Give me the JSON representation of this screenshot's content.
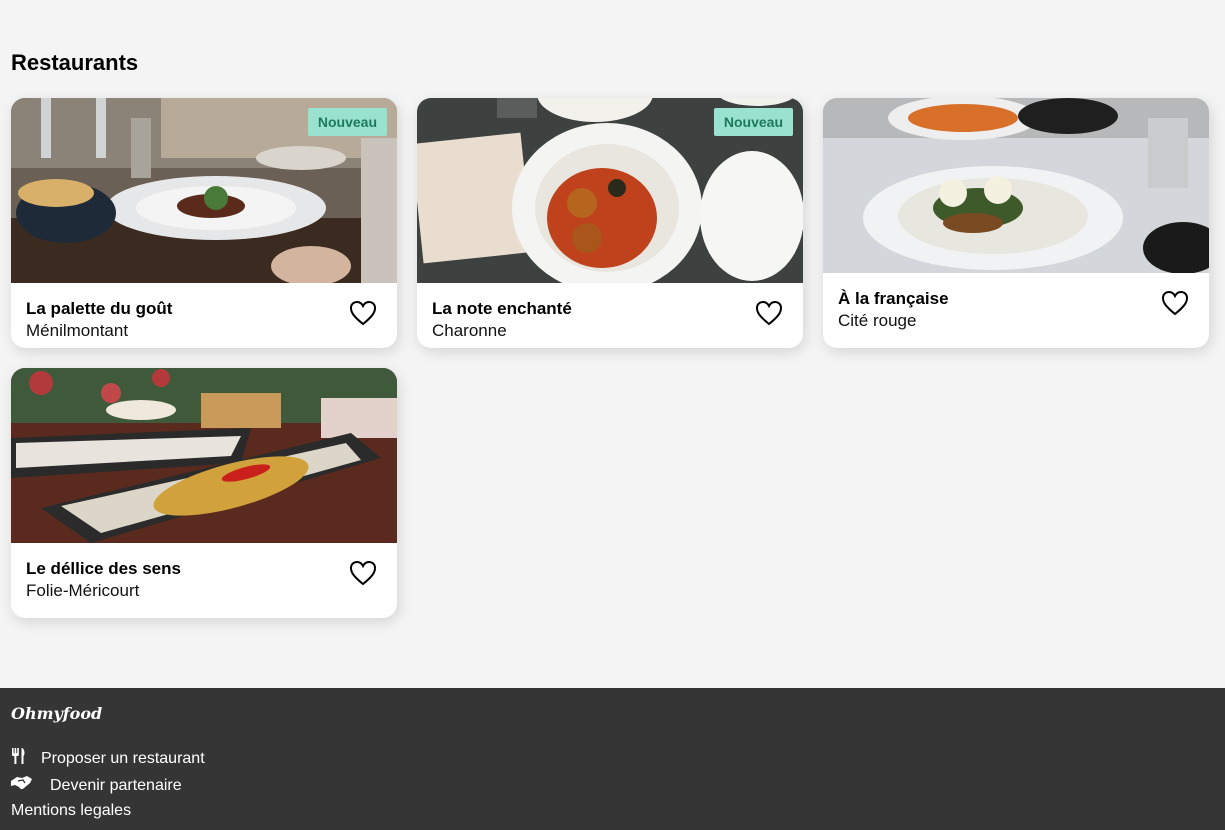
{
  "page": {
    "title": "Restaurants"
  },
  "colors": {
    "background": "#f4f4f4",
    "badge_bg": "#99e2d0",
    "badge_text": "#1f7a5c",
    "footer_bg": "#353535"
  },
  "restaurants": [
    {
      "name": "La palette du goût",
      "area": "Ménilmontant",
      "badge": "Nouveau",
      "icon": "heart-outline-icon"
    },
    {
      "name": "La note enchanté",
      "area": "Charonne",
      "badge": "Nouveau",
      "icon": "heart-outline-icon"
    },
    {
      "name": "À la française",
      "area": "Cité rouge",
      "icon": "heart-outline-icon"
    },
    {
      "name": "Le déllice des sens",
      "area": "Folie-Méricourt",
      "icon": "heart-outline-icon"
    }
  ],
  "footer": {
    "brand": "Ohmyfood",
    "links": [
      {
        "label": "Proposer un restaurant",
        "icon": "utensils-icon"
      },
      {
        "label": "Devenir partenaire",
        "icon": "handshake-icon"
      },
      {
        "label": "Mentions legales"
      }
    ]
  }
}
